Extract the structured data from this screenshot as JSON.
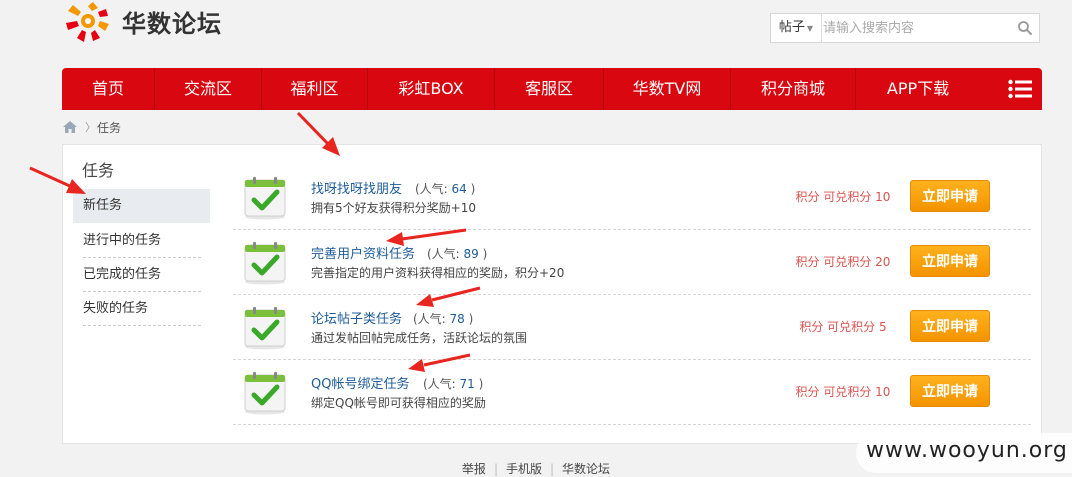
{
  "site": {
    "name": "华数论坛"
  },
  "search": {
    "type": "帖子",
    "placeholder": "请输入搜索内容"
  },
  "nav": {
    "items": [
      "首页",
      "交流区",
      "福利区",
      "彩虹BOX",
      "客服区",
      "华数TV网",
      "积分商城",
      "APP下载"
    ]
  },
  "breadcrumb": {
    "current": "任务",
    "sep": "〉"
  },
  "sidebar": {
    "title": "任务",
    "items": [
      "新任务",
      "进行中的任务",
      "已完成的任务",
      "失败的任务"
    ]
  },
  "tasks": [
    {
      "title": "找呀找呀找朋友",
      "pop_label": "(人气: ",
      "popularity": "64",
      "pop_end": " )",
      "desc": "拥有5个好友获得积分奖励+10",
      "reward": "积分 可兑积分 10",
      "button": "立即申请"
    },
    {
      "title": "完善用户资料任务",
      "pop_label": "(人气: ",
      "popularity": "89",
      "pop_end": " )",
      "desc": "完善指定的用户资料获得相应的奖励，积分+20",
      "reward": "积分 可兑积分 20",
      "button": "立即申请"
    },
    {
      "title": "论坛帖子类任务",
      "pop_label": "(人气: ",
      "popularity": "78",
      "pop_end": " )",
      "desc": "通过发帖回帖完成任务，活跃论坛的氛围",
      "reward": "积分 可兑积分 5",
      "button": "立即申请"
    },
    {
      "title": "QQ帐号绑定任务",
      "pop_label": "(人气: ",
      "popularity": "71",
      "pop_end": " )",
      "desc": "绑定QQ帐号即可获得相应的奖励",
      "reward": "积分 可兑积分 10",
      "button": "立即申请"
    }
  ],
  "footer": {
    "links": [
      "举报",
      "手机版",
      "华数论坛"
    ]
  },
  "watermark": "www.wooyun.org",
  "colors": {
    "brand_red": "#d9070f",
    "button_orange": "#f7a10b",
    "link_blue": "#1f5c99",
    "reward_red": "#d9534f"
  }
}
